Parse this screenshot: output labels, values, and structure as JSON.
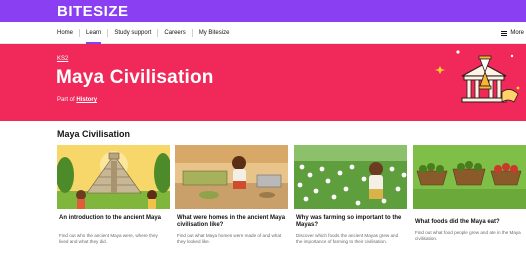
{
  "brand": {
    "name": "BITESIZE"
  },
  "nav": {
    "items": [
      "Home",
      "Learn",
      "Study support",
      "Careers",
      "My Bitesize"
    ],
    "active": "Learn",
    "more_label": "More"
  },
  "hero": {
    "stage": "KS2",
    "title": "Maya Civilisation",
    "part_of_prefix": "Part of",
    "part_of_link": "History"
  },
  "section": {
    "title": "Maya Civilisation"
  },
  "cards": [
    {
      "title": "An introduction to the ancient Maya",
      "description": "Find out who the ancient Maya were, where they lived and what they did."
    },
    {
      "title": "What were homes in the ancient Maya civilisation like?",
      "description": "Find out what Maya homes were made of and what they looked like."
    },
    {
      "title": "Why was farming so important to the Mayas?",
      "description": "Discover which foods the ancient Mayas grew and the importance of farming to their civilisation."
    },
    {
      "title": "What foods did the Maya eat?",
      "description": "Find out what food people grew and ate in the Maya civilisation."
    }
  ],
  "colors": {
    "brand_purple": "#8a3ff3",
    "hero_pink": "#f1295a"
  }
}
